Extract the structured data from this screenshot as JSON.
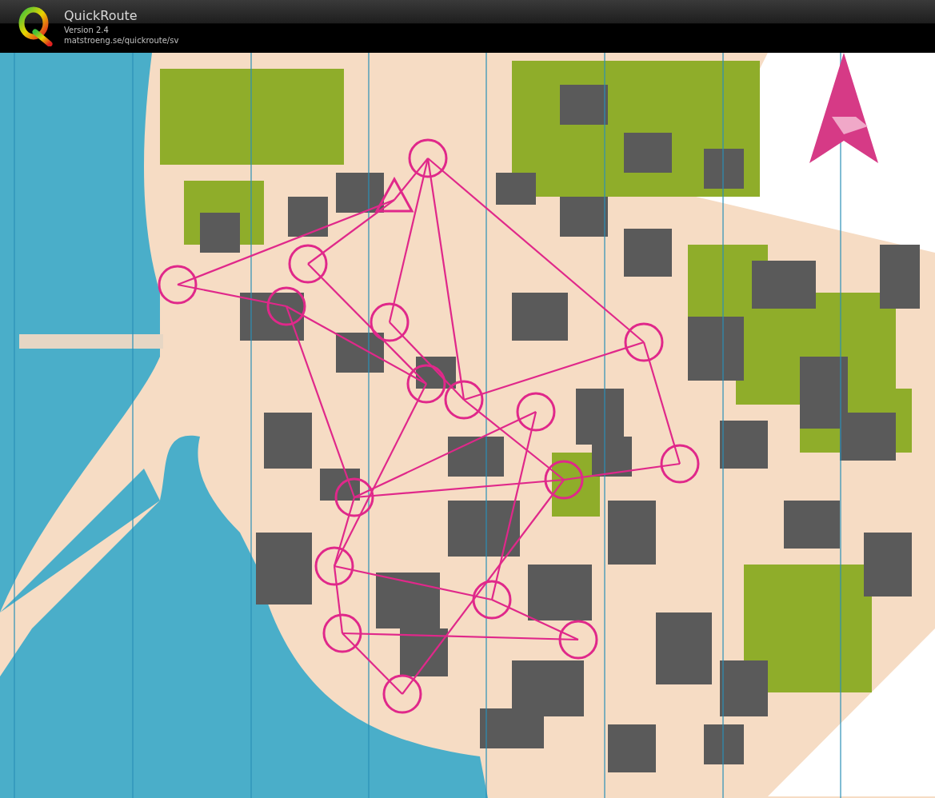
{
  "header": {
    "title": "QuickRoute",
    "version": "Version 2.4",
    "url": "matstroeng.se/quickroute/sv"
  }
}
